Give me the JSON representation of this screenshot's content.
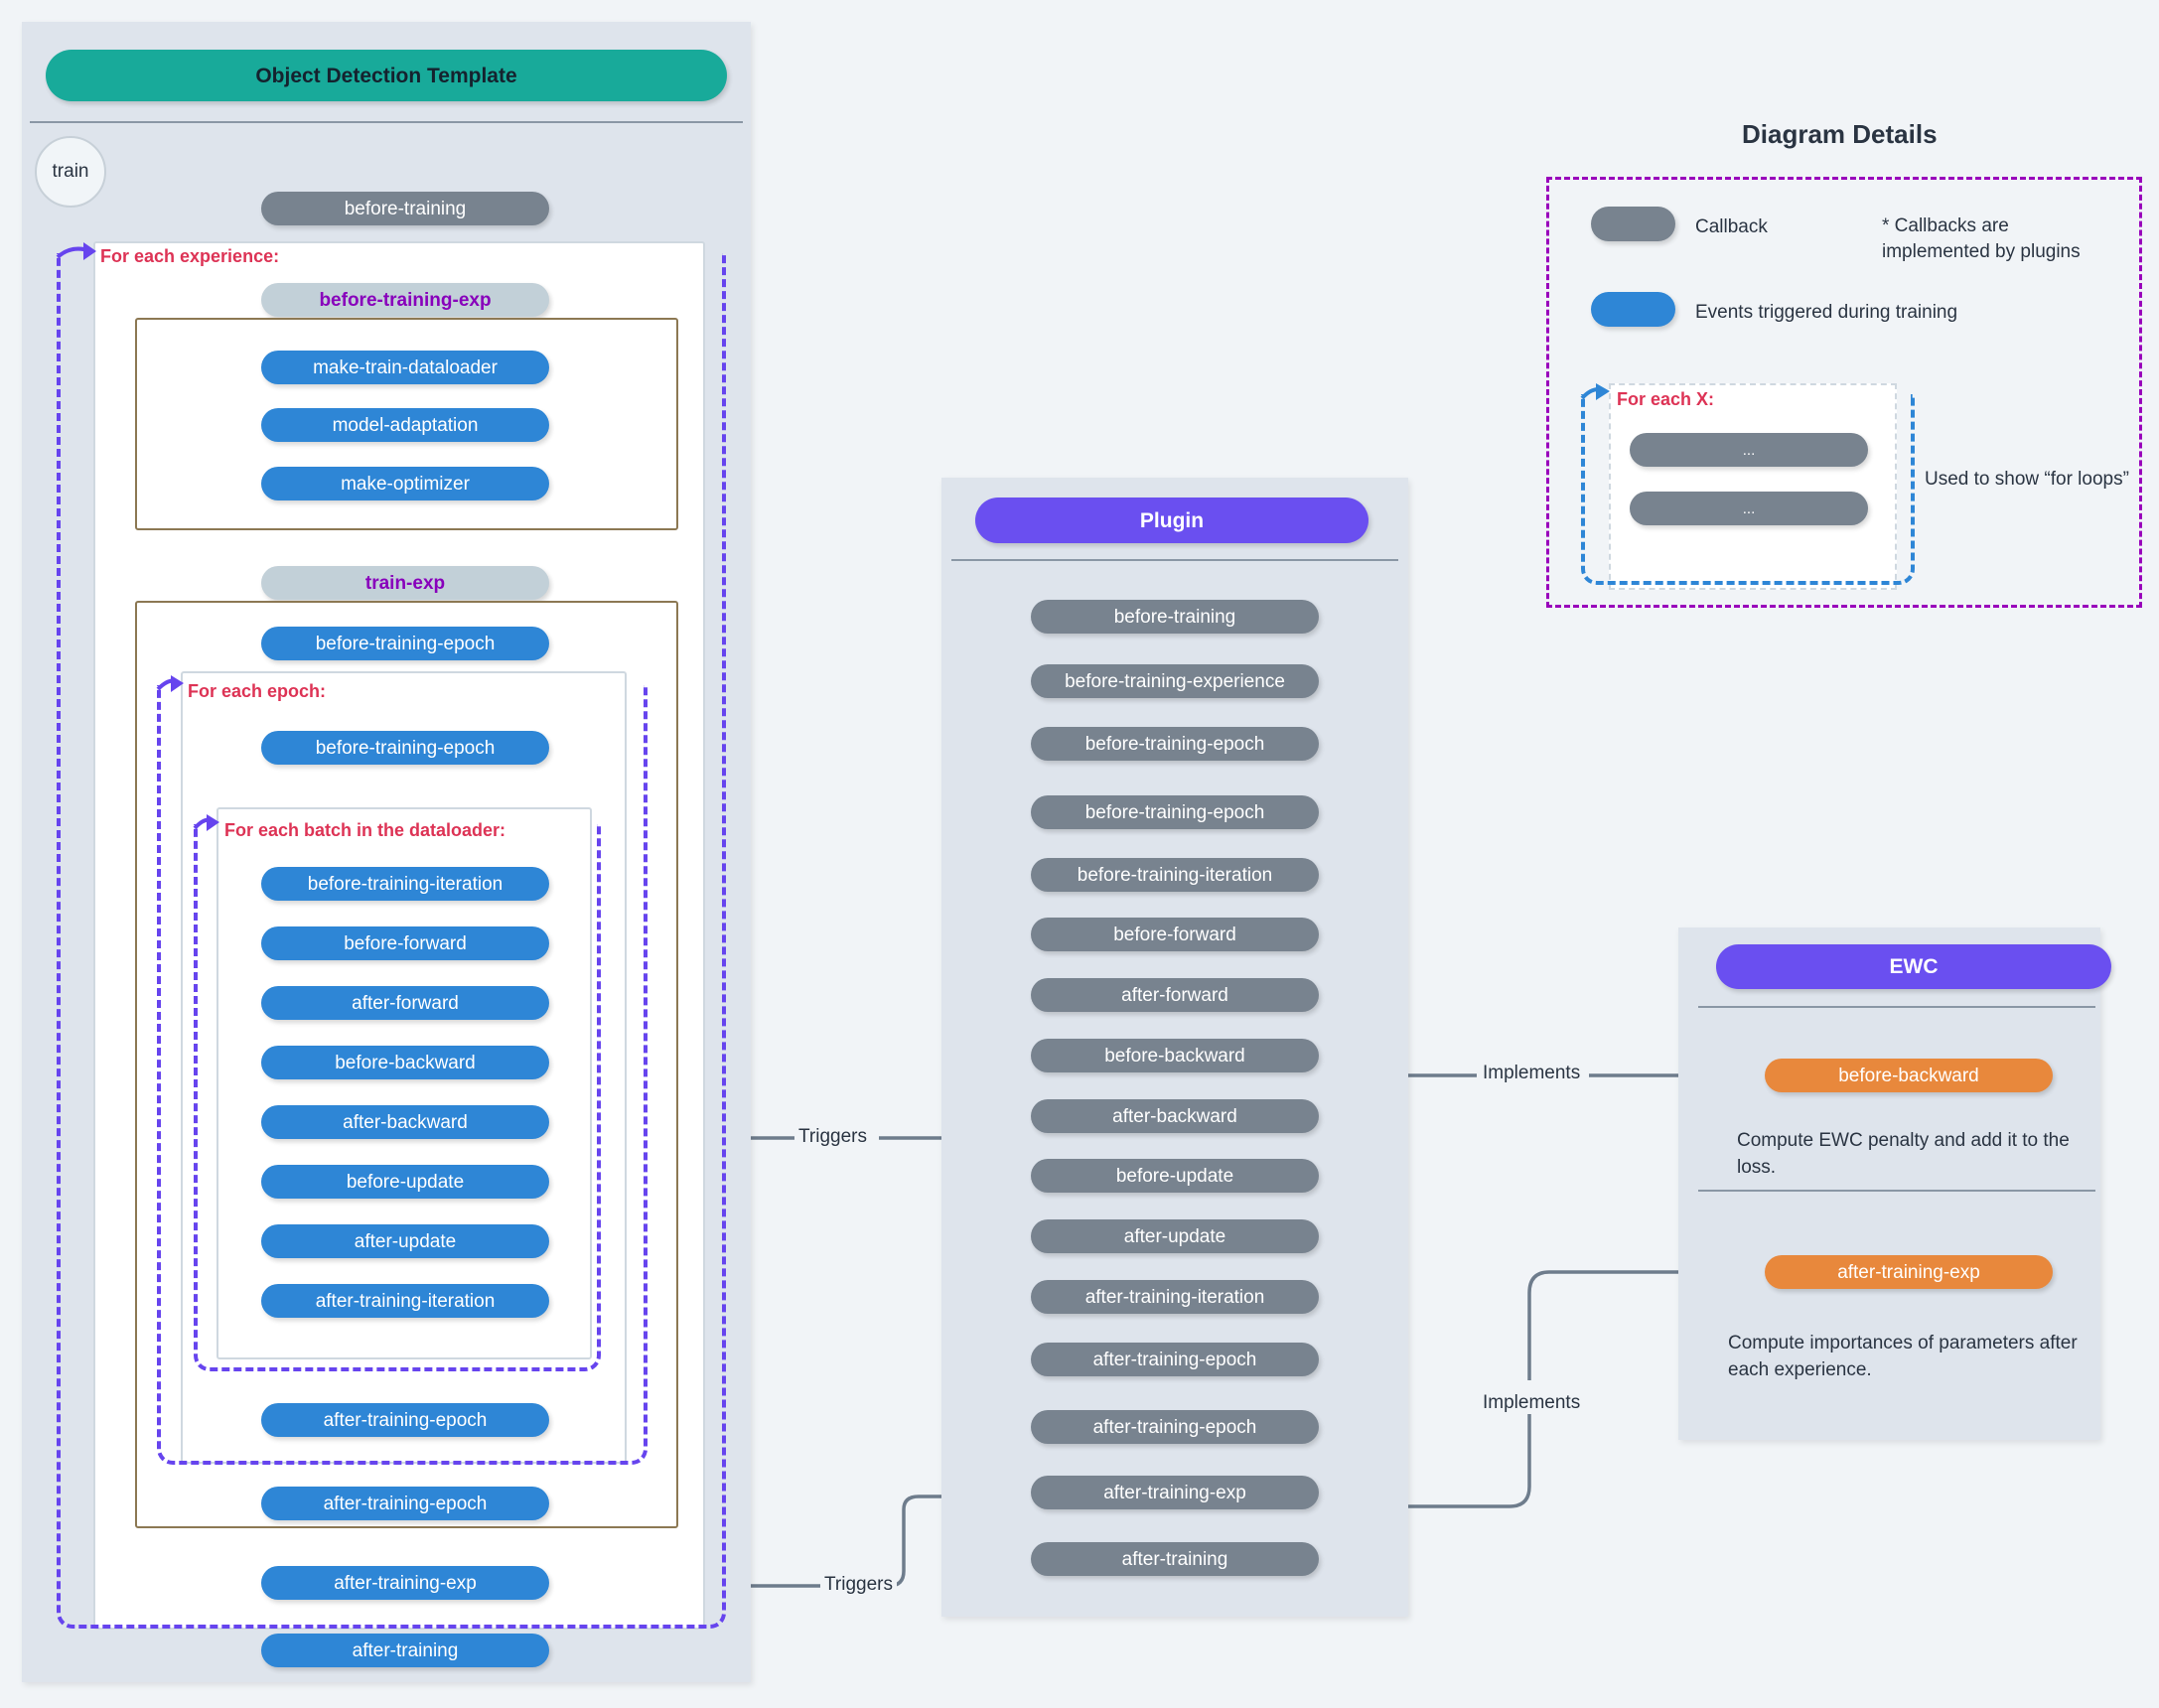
{
  "template_panel": {
    "title": "Object Detection Template",
    "entry_node": "train",
    "top_callback": "before-training",
    "bottom_event": "after-training",
    "loops": {
      "experience": "For each experience:",
      "epoch": "For each epoch:",
      "batch": "For each batch in the dataloader:"
    },
    "phases": {
      "before_training_exp": "before-training-exp",
      "train_exp": "train-exp"
    },
    "setup_events": [
      "make-train-dataloader",
      "model-adaptation",
      "make-optimizer"
    ],
    "epoch_pre_event": "before-training-epoch",
    "epoch_inner_event": "before-training-epoch",
    "batch_events": [
      "before-training-iteration",
      "before-forward",
      "after-forward",
      "before-backward",
      "after-backward",
      "before-update",
      "after-update",
      "after-training-iteration"
    ],
    "epoch_post_event": "after-training-epoch",
    "exp_post_epoch_event": "after-training-epoch",
    "exp_post_event": "after-training-exp"
  },
  "plugin_panel": {
    "title": "Plugin",
    "callbacks": [
      "before-training",
      "before-training-experience",
      "before-training-epoch",
      "before-training-epoch",
      "before-training-iteration",
      "before-forward",
      "after-forward",
      "before-backward",
      "after-backward",
      "before-update",
      "after-update",
      "after-training-iteration",
      "after-training-epoch",
      "after-training-epoch",
      "after-training-exp",
      "after-training"
    ]
  },
  "ewc_panel": {
    "title": "EWC",
    "entries": [
      {
        "hook": "before-backward",
        "description": "Compute EWC penalty and add it to the loss."
      },
      {
        "hook": "after-training-exp",
        "description": "Compute importances of parameters after each experience."
      }
    ]
  },
  "details_panel": {
    "title": "Diagram Details",
    "legend": [
      {
        "label": "Callback",
        "color": "#78838F"
      },
      {
        "label": "Events triggered during training",
        "color": "#2E86D6"
      }
    ],
    "footnote": "* Callbacks are\nimplemented by plugins",
    "loop_example": {
      "label": "For each X:",
      "items": [
        "...",
        "..."
      ],
      "caption": "Used to show “for loops”"
    }
  },
  "edges": {
    "triggers_backward": "Triggers",
    "triggers_exp": "Triggers",
    "implements_backward": "Implements",
    "implements_exp": "Implements"
  },
  "colors": {
    "event": "#2E86D6",
    "callback": "#78838F",
    "phase_bg": "#C2D0D8",
    "phase_text": "#8800BB",
    "template_header": "#18AA9A",
    "plugin_header": "#6A4FF0",
    "strategy_hook": "#E8883C",
    "loop_dash": "#6644EE",
    "loop_label": "#DD3355",
    "details_border": "#9900BB",
    "panel_bg": "#DEE4EC",
    "page_bg": "#F1F4F7"
  }
}
